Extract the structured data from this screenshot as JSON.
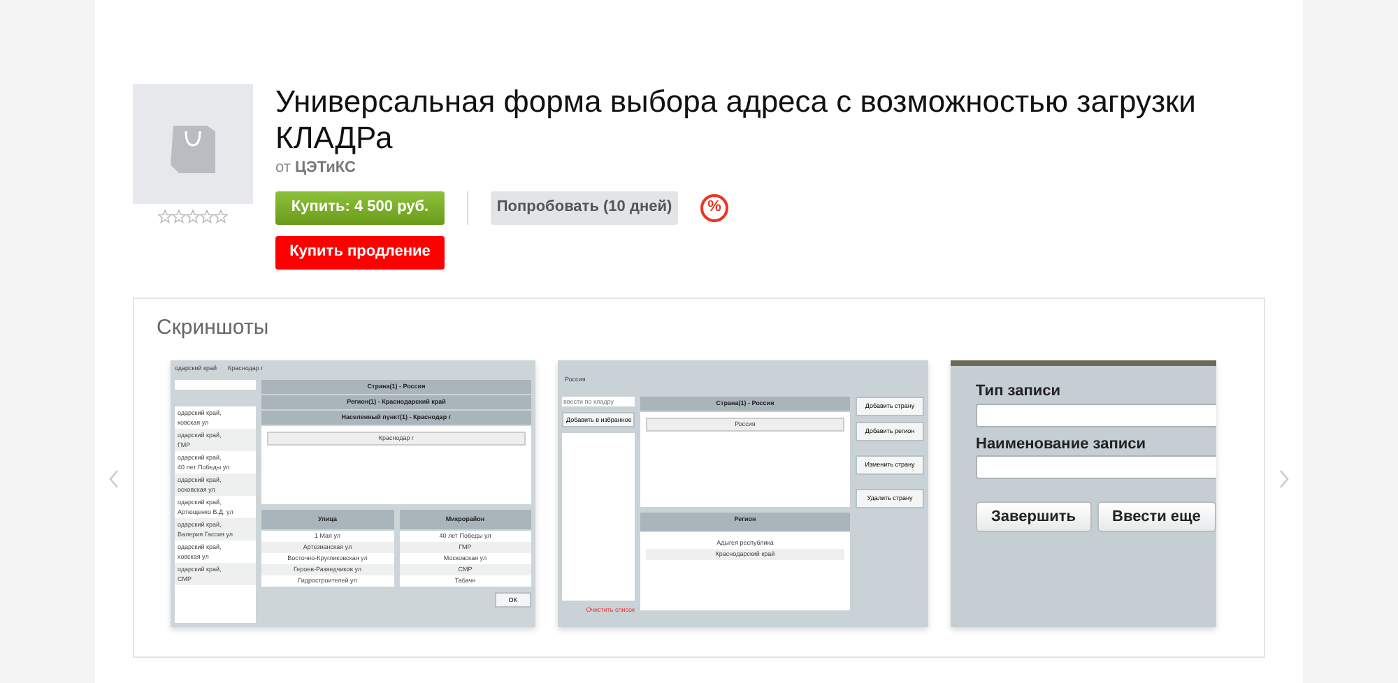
{
  "product": {
    "title": "Универсальная форма выбора адреса с возможностью загрузки КЛАДРа",
    "vendor_prefix": "от",
    "vendor": "ЦЭТиКС",
    "stars": 0,
    "buy_button": "Купить: 4 500 руб.",
    "try_button": "Попробовать (10 дней)",
    "discount_badge": "%",
    "renew_button": "Купить продление"
  },
  "screenshots": {
    "title": "Скриншоты",
    "shot_1": {
      "breadcrumb": [
        "одарский край",
        "Краснодар г"
      ],
      "list_items": [
        [
          "одарский край,",
          "ковская ул"
        ],
        [
          "одарский край,",
          "ГМР"
        ],
        [
          "одарский край,",
          "40 лет Победы ул"
        ],
        [
          "одарский край,",
          "осковская ул"
        ],
        [
          "одарский край,",
          "Артющенко В.Д. ул"
        ],
        [
          "одарский край,",
          "Валерия Гассия ул"
        ],
        [
          "одарский край,",
          "ховская ул"
        ],
        [
          "одарский край,",
          "СМР"
        ]
      ],
      "headers": [
        "Страна(1) - Россия",
        "Регион(1) - Краснодарский край",
        "Населенный пункт(1) - Краснодар г"
      ],
      "selected_item": "Краснодар г",
      "columns": [
        {
          "heading": "Улица",
          "items": [
            "1 Мая ул",
            "Артезианская ул",
            "Восточно-Кругликовская ул",
            "Героев-Разведчиков ул",
            "Гидростроителей ул"
          ]
        },
        {
          "heading": "Микрорайон",
          "items": [
            "40 лет Победы ул",
            "ГМР",
            "Московская ул",
            "СМР",
            "Табачн"
          ]
        }
      ],
      "ok_button": "OK"
    },
    "shot_2": {
      "title": "Россия",
      "search_placeholder": "ввести по кладру",
      "favorite_button": "Добавить в избранное",
      "clear_link": "Очистить список",
      "country_header": "Страна(1) - Россия",
      "country_item": "Россия",
      "region_header": "Регион",
      "regions": [
        "Адыгея республика",
        "Краснодарский край"
      ],
      "actions": [
        "Добавить страну",
        "Добавить регион",
        "Изменить страну",
        "Удалить страну"
      ]
    },
    "shot_3": {
      "fields": [
        "Тип записи",
        "Наименование записи"
      ],
      "buttons": [
        "Завершить",
        "Ввести еще"
      ]
    }
  }
}
